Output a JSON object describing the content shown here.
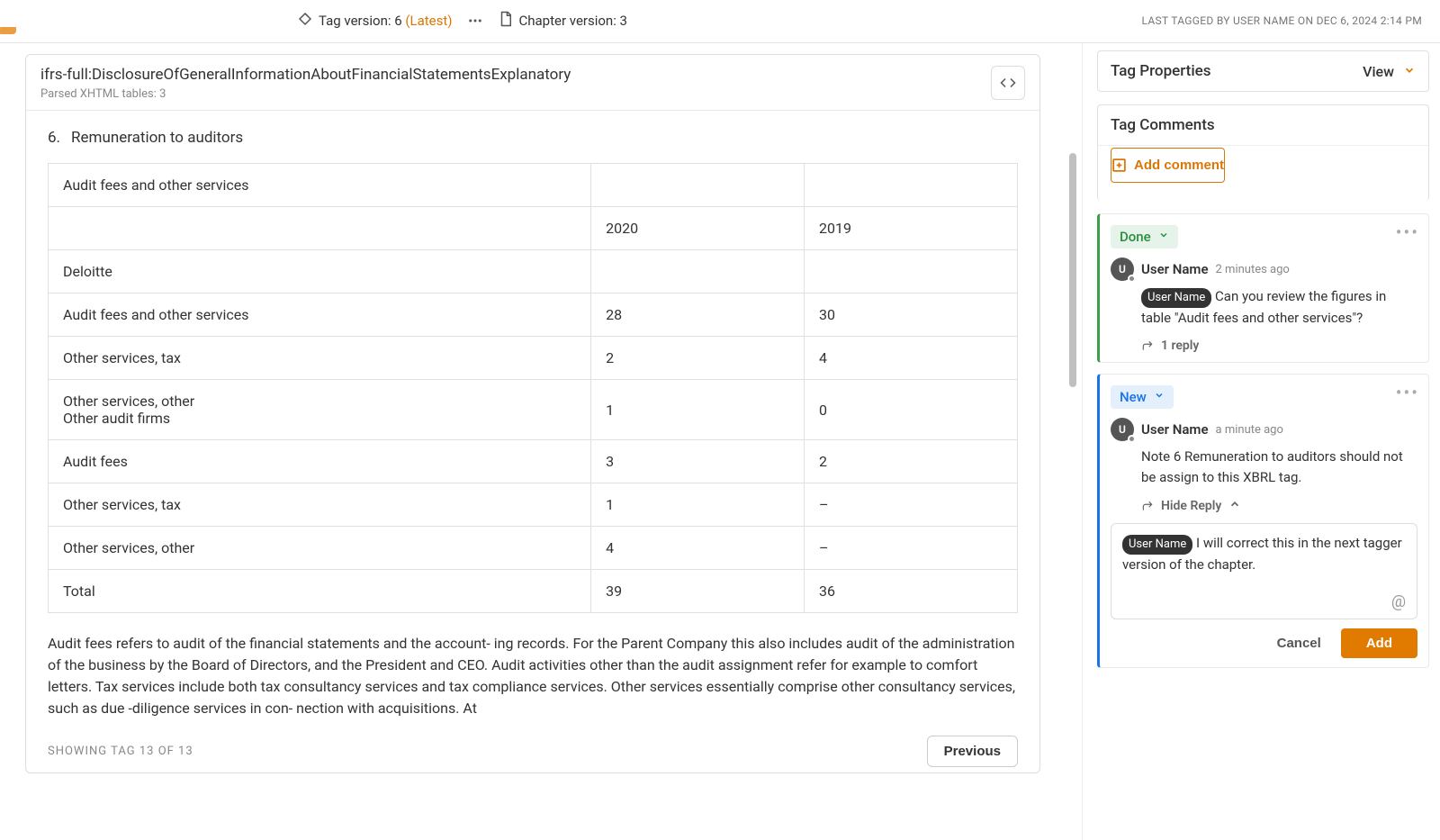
{
  "topbar": {
    "tag_version_label": "Tag version: 6",
    "latest_label": "(Latest)",
    "chapter_version_label": "Chapter version: 3",
    "last_tagged": "LAST TAGGED BY  USER NAME  ON  DEC 6, 2024 2:14 PM"
  },
  "tag": {
    "name": "ifrs-full:DisclosureOfGeneralInformationAboutFinancialStatementsExplanatory",
    "subtitle": "Parsed XHTML tables: 3",
    "section_number": "6.",
    "section_title": "Remuneration to auditors"
  },
  "table": {
    "caption": "Audit fees and other services",
    "years": [
      "2020",
      "2019"
    ],
    "rows": [
      {
        "label": "Deloitte",
        "v1": "",
        "v2": ""
      },
      {
        "label": "Audit fees and other services",
        "v1": "28",
        "v2": "30"
      },
      {
        "label": "Other services, tax",
        "v1": "2",
        "v2": "4"
      },
      {
        "label": "Other services, other\nOther audit firms",
        "v1": "1",
        "v2": "0"
      },
      {
        "label": "Audit fees",
        "v1": "3",
        "v2": "2"
      },
      {
        "label": "Other services, tax",
        "v1": "1",
        "v2": "–"
      },
      {
        "label": "Other services, other",
        "v1": "4",
        "v2": "–"
      },
      {
        "label": "Total",
        "v1": "39",
        "v2": "36"
      }
    ]
  },
  "description": "Audit fees refers to audit of the financial statements and the account- ing records. For the Parent Company this also includes audit of the administration of the business by the Board of Directors, and the President and CEO. Audit activities other than the audit assignment refer for example to comfort letters. Tax services include both tax consultancy services and tax compliance services. Other services essentially comprise other consultancy services, such as due -diligence services in con- nection with acquisitions. At",
  "footer": {
    "counter": "SHOWING TAG 13 OF 13",
    "previous": "Previous"
  },
  "sidebar": {
    "properties_title": "Tag Properties",
    "view_label": "View",
    "comments_title": "Tag Comments",
    "add_comment": "Add comment",
    "comments": [
      {
        "status": "Done",
        "avatar": "U",
        "user": "User Name",
        "time": "2 minutes ago",
        "mention": "User Name",
        "body": "Can you review the figures in table \"Audit fees and other services\"?",
        "reply_label": "1 reply"
      },
      {
        "status": "New",
        "avatar": "U",
        "user": "User Name",
        "time": "a minute ago",
        "body": "Note 6 Remuneration to auditors should not be assign to this XBRL tag.",
        "hide_reply": "Hide Reply"
      }
    ],
    "reply_draft": {
      "mention": "User Name",
      "text": "I will correct this in the next tagger version of the chapter.",
      "cancel": "Cancel",
      "add": "Add"
    }
  }
}
